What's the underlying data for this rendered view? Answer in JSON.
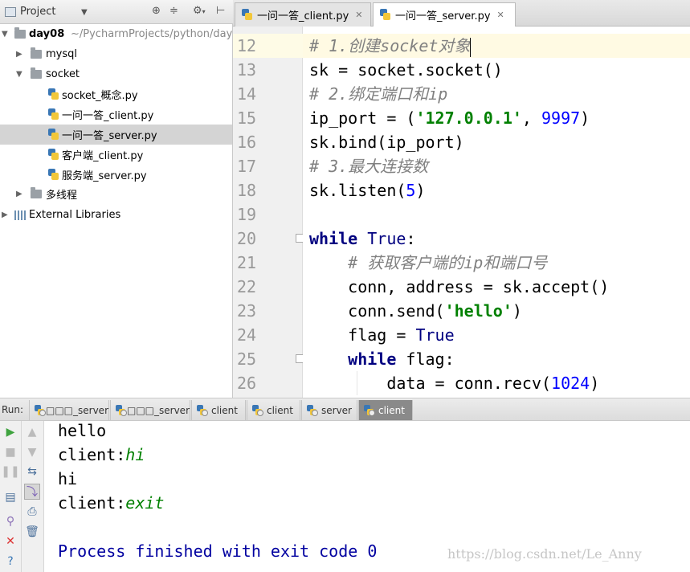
{
  "project_panel": {
    "title": "Project",
    "tree": [
      {
        "label": "day08",
        "path": "~/PycharmProjects/python/day"
      },
      {
        "label": "mysql"
      },
      {
        "label": "socket"
      },
      {
        "label": "socket_概念.py"
      },
      {
        "label": "一问一答_client.py"
      },
      {
        "label": "一问一答_server.py"
      },
      {
        "label": "客户端_client.py"
      },
      {
        "label": "服务端_server.py"
      },
      {
        "label": "多线程"
      },
      {
        "label": "External Libraries"
      }
    ]
  },
  "editor": {
    "tabs": [
      {
        "label": "一问一答_client.py",
        "active": false
      },
      {
        "label": "一问一答_server.py",
        "active": true
      }
    ],
    "current_line": 12,
    "lines": [
      {
        "no": "12",
        "tokens": [
          {
            "t": "# 1.创建socket对象",
            "c": "cmt"
          }
        ]
      },
      {
        "no": "13",
        "tokens": [
          {
            "t": "sk = socket.socket()",
            "c": ""
          }
        ]
      },
      {
        "no": "14",
        "tokens": [
          {
            "t": "# 2.绑定端口和ip",
            "c": "cmt"
          }
        ]
      },
      {
        "no": "15",
        "tokens": [
          {
            "t": "ip_port = (",
            "c": ""
          },
          {
            "t": "'127.0.0.1'",
            "c": "str"
          },
          {
            "t": ", ",
            "c": ""
          },
          {
            "t": "9997",
            "c": "num"
          },
          {
            "t": ")",
            "c": ""
          }
        ]
      },
      {
        "no": "16",
        "tokens": [
          {
            "t": "sk.bind(ip_port)",
            "c": ""
          }
        ]
      },
      {
        "no": "17",
        "tokens": [
          {
            "t": "# 3.最大连接数",
            "c": "cmt"
          }
        ]
      },
      {
        "no": "18",
        "tokens": [
          {
            "t": "sk.listen(",
            "c": ""
          },
          {
            "t": "5",
            "c": "num"
          },
          {
            "t": ")",
            "c": ""
          }
        ]
      },
      {
        "no": "19",
        "tokens": []
      },
      {
        "no": "20",
        "tokens": [
          {
            "t": "while",
            "c": "kw"
          },
          {
            "t": " ",
            "c": ""
          },
          {
            "t": "True",
            "c": "kwc"
          },
          {
            "t": ":",
            "c": ""
          }
        ]
      },
      {
        "no": "21",
        "tokens": [
          {
            "t": "    ",
            "c": ""
          },
          {
            "t": "# 获取客户端的ip和端口号",
            "c": "cmt"
          }
        ]
      },
      {
        "no": "22",
        "tokens": [
          {
            "t": "    conn, address = sk.accept()",
            "c": ""
          }
        ]
      },
      {
        "no": "23",
        "tokens": [
          {
            "t": "    conn.send(",
            "c": ""
          },
          {
            "t": "'hello'",
            "c": "str"
          },
          {
            "t": ")",
            "c": ""
          }
        ]
      },
      {
        "no": "24",
        "tokens": [
          {
            "t": "    flag = ",
            "c": ""
          },
          {
            "t": "True",
            "c": "kwc"
          }
        ]
      },
      {
        "no": "25",
        "tokens": [
          {
            "t": "    ",
            "c": ""
          },
          {
            "t": "while",
            "c": "kw"
          },
          {
            "t": " flag:",
            "c": ""
          }
        ]
      },
      {
        "no": "26",
        "tokens": [
          {
            "t": "        data = conn.recv(",
            "c": ""
          },
          {
            "t": "1024",
            "c": "num"
          },
          {
            "t": ")",
            "c": ""
          }
        ]
      }
    ]
  },
  "run_panel": {
    "label": "Run:",
    "tabs": [
      {
        "label": "□□□_server",
        "active": false
      },
      {
        "label": "□□□_server",
        "active": false
      },
      {
        "label": "client",
        "active": false
      },
      {
        "label": "client",
        "active": false
      },
      {
        "label": "server",
        "active": false
      },
      {
        "label": "client",
        "active": true
      }
    ],
    "console": {
      "line1": "hello",
      "line2_prefix": "client:",
      "line2_input": "hi",
      "line3": "hi",
      "line4_prefix": "client:",
      "line4_input": "exit",
      "process": "Process finished with exit code 0"
    },
    "watermark": "https://blog.csdn.net/Le_Anny"
  },
  "icons": [
    "project-icon",
    "caret-down-icon",
    "sync-icon",
    "collapse-icon",
    "gear-icon",
    "hide-icon",
    "folder-icon",
    "python-file-icon",
    "library-icon",
    "run-icon",
    "stop-icon",
    "pause-icon",
    "up-icon",
    "down-icon",
    "rerun-icon",
    "layout-icon",
    "soft-wrap-icon",
    "print-icon",
    "pin-icon",
    "close-icon",
    "trash-icon",
    "help-icon"
  ]
}
